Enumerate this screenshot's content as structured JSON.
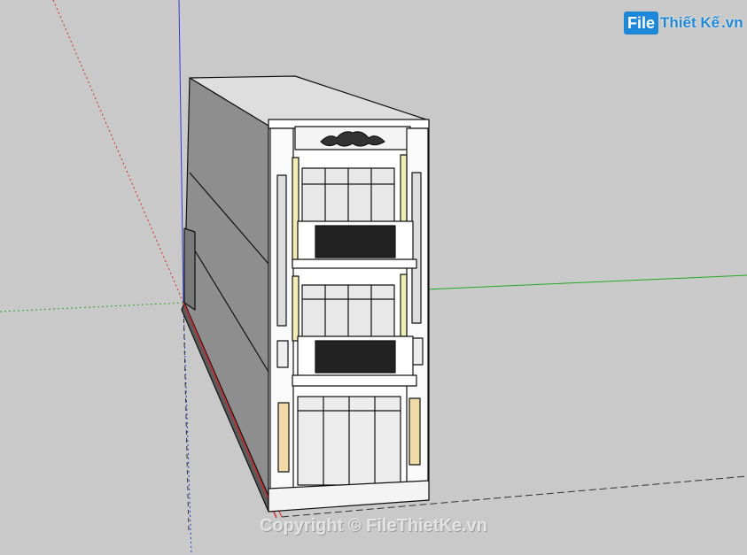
{
  "logo": {
    "prefix": "File",
    "text": "Thiết Kế",
    "suffix": ".vn"
  },
  "watermark": "Copyright © FileThietKe.vn",
  "colors": {
    "background": "#c9c9c9",
    "axis_red": "#d42a2a",
    "axis_green": "#22a822",
    "axis_blue": "#2a3ad4",
    "facade": "#ffffff",
    "side_wall": "#8c8c8c",
    "accent_yellow": "#f3ecb4"
  }
}
